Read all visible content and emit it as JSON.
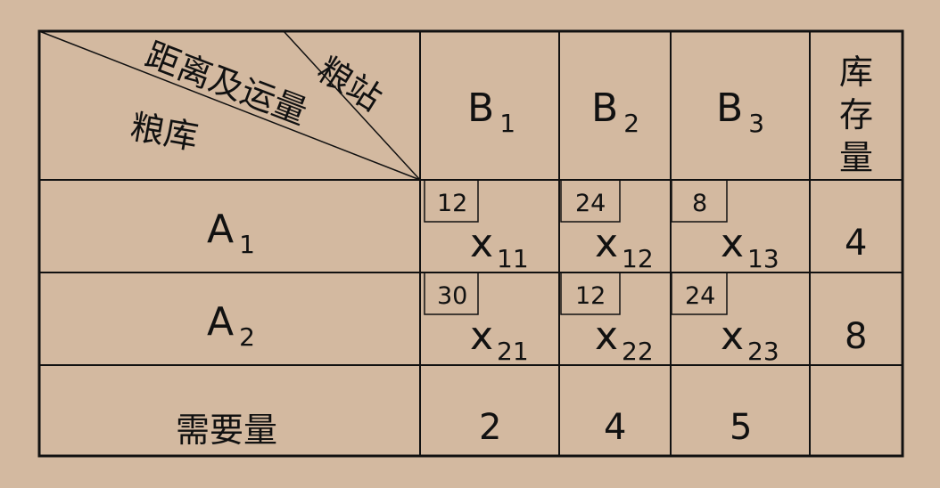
{
  "corner": {
    "top_label": "粮站",
    "middle_label": "距离及运量",
    "left_label": "粮库"
  },
  "columns": [
    {
      "base": "B",
      "sub": "1"
    },
    {
      "base": "B",
      "sub": "2"
    },
    {
      "base": "B",
      "sub": "3"
    }
  ],
  "stock_header": [
    "库",
    "存",
    "量"
  ],
  "rows": [
    {
      "label": {
        "base": "A",
        "sub": "1"
      },
      "cells": [
        {
          "distance": "12",
          "var_base": "x",
          "var_sub": "11"
        },
        {
          "distance": "24",
          "var_base": "x",
          "var_sub": "12"
        },
        {
          "distance": "8",
          "var_base": "x",
          "var_sub": "13"
        }
      ],
      "stock": "4"
    },
    {
      "label": {
        "base": "A",
        "sub": "2"
      },
      "cells": [
        {
          "distance": "30",
          "var_base": "x",
          "var_sub": "21"
        },
        {
          "distance": "12",
          "var_base": "x",
          "var_sub": "22"
        },
        {
          "distance": "24",
          "var_base": "x",
          "var_sub": "23"
        }
      ],
      "stock": "8"
    }
  ],
  "demand": {
    "label": "需要量",
    "values": [
      "2",
      "4",
      "5"
    ]
  }
}
